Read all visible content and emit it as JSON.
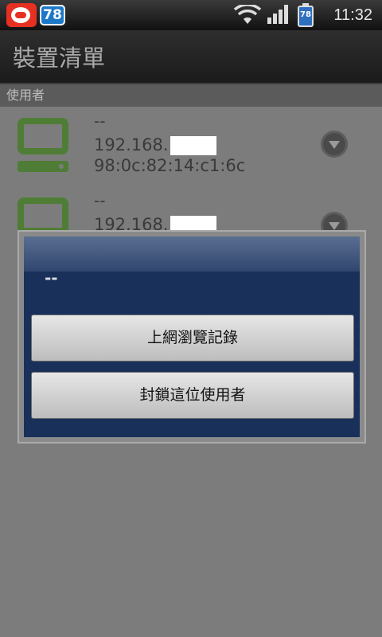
{
  "status_bar": {
    "notification_count": "78",
    "battery_level": "78",
    "time": "11:32"
  },
  "header": {
    "title": "裝置清單"
  },
  "section": {
    "label": "使用者"
  },
  "devices": [
    {
      "name": "--",
      "ip_prefix": "192.168.",
      "mac": "98:0c:82:14:c1:6c"
    },
    {
      "name": "--",
      "ip_prefix": "192.168.",
      "mac": ""
    }
  ],
  "dialog": {
    "title": "--",
    "buttons": [
      {
        "label": "上網瀏覽記錄"
      },
      {
        "label": "封鎖這位使用者"
      }
    ]
  },
  "colors": {
    "device_icon": "#4f7d35",
    "dialog_background": "#19305a"
  }
}
